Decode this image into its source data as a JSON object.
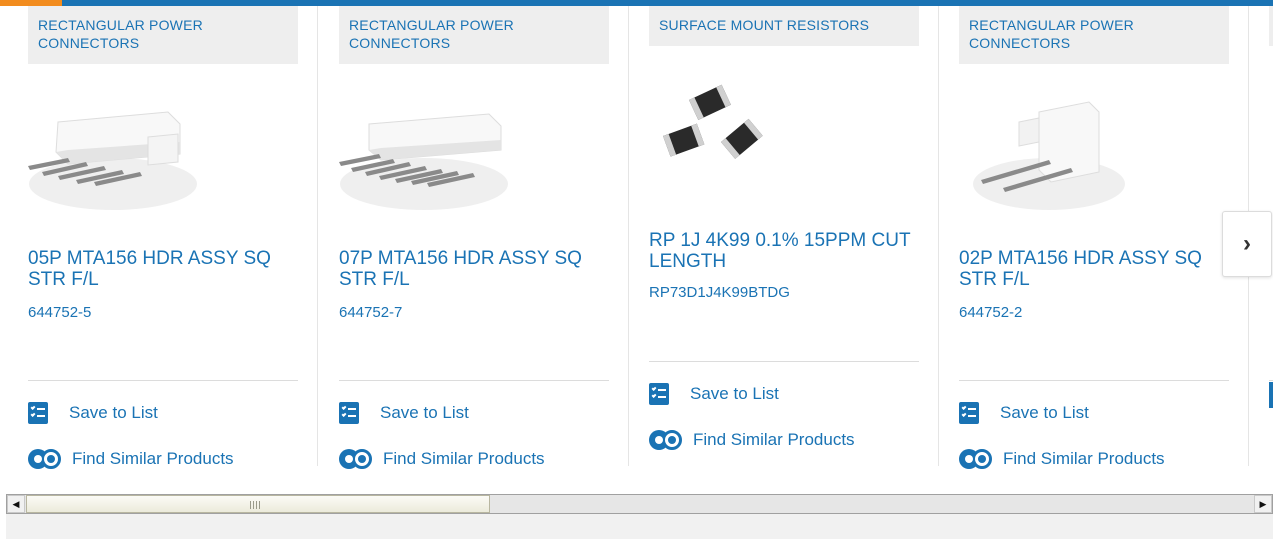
{
  "cards": [
    {
      "category": "RECTANGULAR POWER CONNECTORS",
      "title": "05P MTA156 HDR ASSY SQ STR F/L",
      "part_number": "644752-5",
      "save_label": "Save to List",
      "similar_label": "Find Similar Products",
      "image": "5-pin-header-connector"
    },
    {
      "category": "RECTANGULAR POWER CONNECTORS",
      "title": "07P MTA156 HDR ASSY SQ STR F/L",
      "part_number": "644752-7",
      "save_label": "Save to List",
      "similar_label": "Find Similar Products",
      "image": "7-pin-header-connector"
    },
    {
      "category": "SURFACE MOUNT RESISTORS",
      "title": "RP 1J 4K99 0.1% 15PPM CUT LENGTH",
      "part_number": "RP73D1J4K99BTDG",
      "save_label": "Save to List",
      "similar_label": "Find Similar Products",
      "image": "smd-resistor-chips"
    },
    {
      "category": "RECTANGULAR POWER CONNECTORS",
      "title": "02P MTA156 HDR ASSY SQ STR F/L",
      "part_number": "644752-2",
      "save_label": "Save to List",
      "similar_label": "Find Similar Products",
      "image": "2-pin-header-connector"
    }
  ],
  "next_button": {
    "glyph": "›",
    "icon": "chevron-right-icon"
  },
  "scrollbar": {
    "left_arrow": "◀",
    "right_arrow": "▶"
  },
  "colors": {
    "accent": "#1a73b4",
    "top_accent": "#f28c1e",
    "category_bg": "#eeeeee"
  }
}
